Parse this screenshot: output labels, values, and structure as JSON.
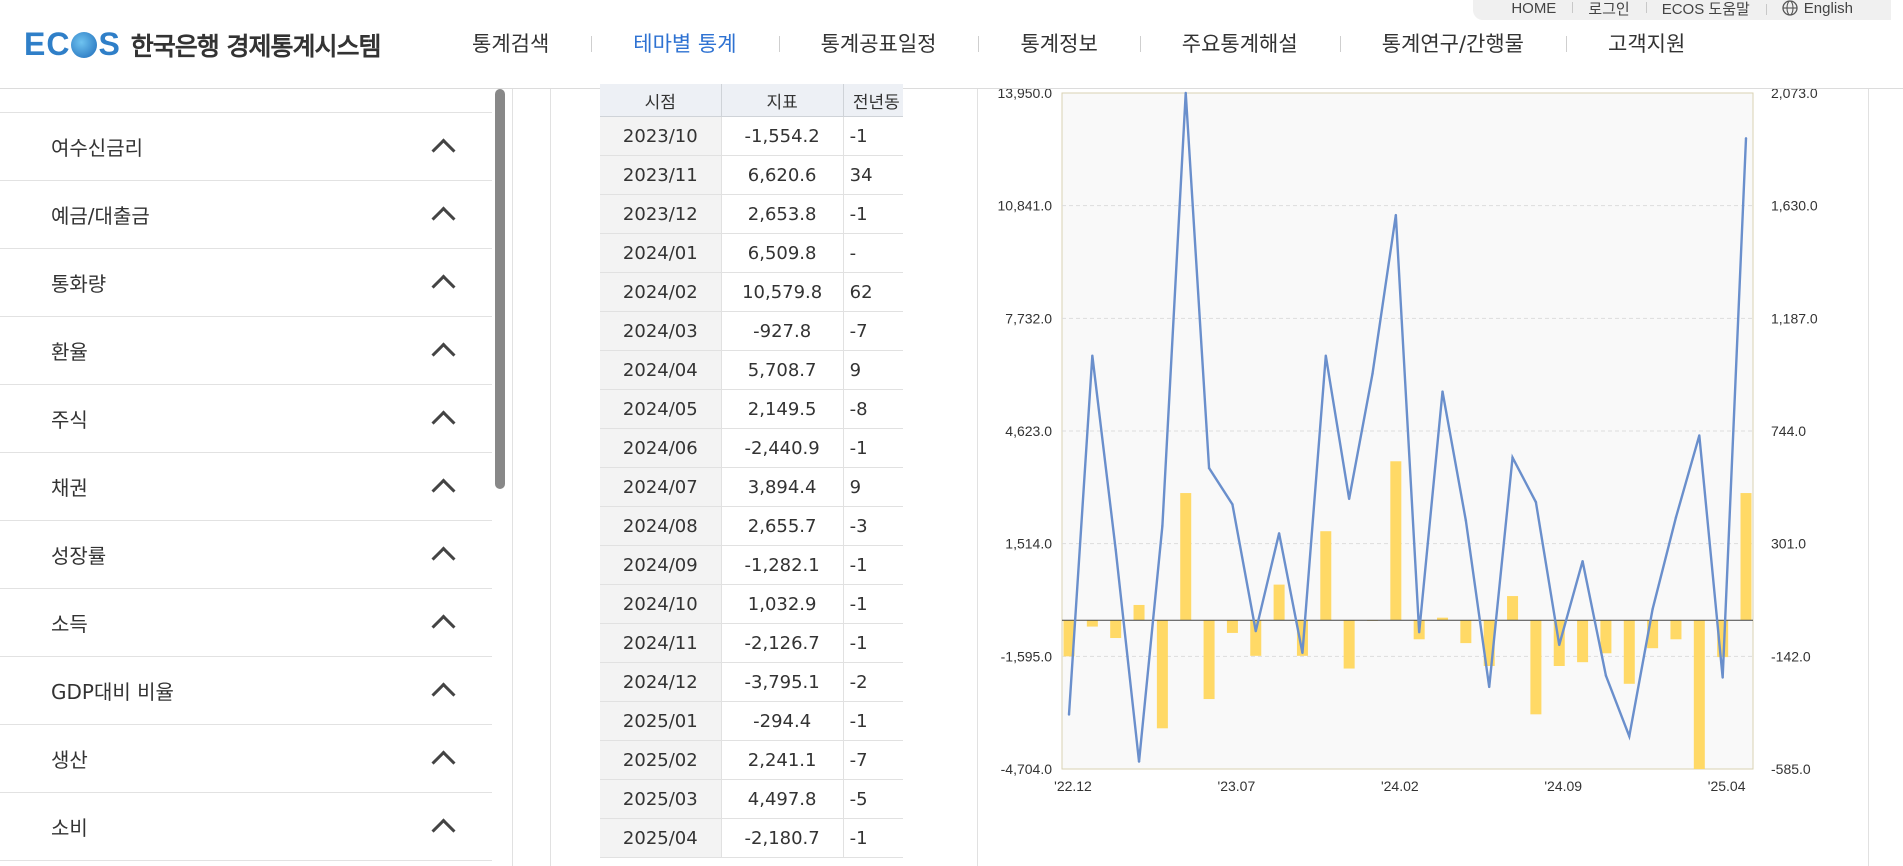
{
  "header": {
    "logo_mark": "ECOS",
    "logo_text": "한국은행 경제통계시스템",
    "nav": [
      {
        "label": "통계검색",
        "active": false
      },
      {
        "label": "테마별 통계",
        "active": true
      },
      {
        "label": "통계공표일정",
        "active": false
      },
      {
        "label": "통계정보",
        "active": false
      },
      {
        "label": "주요통계해설",
        "active": false
      },
      {
        "label": "통계연구/간행물",
        "active": false
      },
      {
        "label": "고객지원",
        "active": false
      }
    ],
    "util": {
      "home": "HOME",
      "login": "로그인",
      "help": "ECOS 도움말",
      "english": "English"
    }
  },
  "sidebar": {
    "items": [
      {
        "label": "여수신금리"
      },
      {
        "label": "예금/대출금"
      },
      {
        "label": "통화량"
      },
      {
        "label": "환율"
      },
      {
        "label": "주식"
      },
      {
        "label": "채권"
      },
      {
        "label": "성장률"
      },
      {
        "label": "소득"
      },
      {
        "label": "GDP대비 비율"
      },
      {
        "label": "생산"
      },
      {
        "label": "소비"
      }
    ]
  },
  "table": {
    "headers": [
      "시점",
      "지표",
      "전년동"
    ],
    "rows": [
      {
        "date": "2023/10",
        "value": "-1,554.2",
        "yoy": "-1"
      },
      {
        "date": "2023/11",
        "value": "6,620.6",
        "yoy": "34"
      },
      {
        "date": "2023/12",
        "value": "2,653.8",
        "yoy": "-1"
      },
      {
        "date": "2024/01",
        "value": "6,509.8",
        "yoy": "-"
      },
      {
        "date": "2024/02",
        "value": "10,579.8",
        "yoy": "62"
      },
      {
        "date": "2024/03",
        "value": "-927.8",
        "yoy": "-7"
      },
      {
        "date": "2024/04",
        "value": "5,708.7",
        "yoy": "9"
      },
      {
        "date": "2024/05",
        "value": "2,149.5",
        "yoy": "-8"
      },
      {
        "date": "2024/06",
        "value": "-2,440.9",
        "yoy": "-1"
      },
      {
        "date": "2024/07",
        "value": "3,894.4",
        "yoy": "9"
      },
      {
        "date": "2024/08",
        "value": "2,655.7",
        "yoy": "-3"
      },
      {
        "date": "2024/09",
        "value": "-1,282.1",
        "yoy": "-1"
      },
      {
        "date": "2024/10",
        "value": "1,032.9",
        "yoy": "-1"
      },
      {
        "date": "2024/11",
        "value": "-2,126.7",
        "yoy": "-1"
      },
      {
        "date": "2024/12",
        "value": "-3,795.1",
        "yoy": "-2"
      },
      {
        "date": "2025/01",
        "value": "-294.4",
        "yoy": "-1"
      },
      {
        "date": "2025/02",
        "value": "2,241.1",
        "yoy": "-7"
      },
      {
        "date": "2025/03",
        "value": "4,497.8",
        "yoy": "-5"
      },
      {
        "date": "2025/04",
        "value": "-2,180.7",
        "yoy": "-1"
      }
    ]
  },
  "chart_data": {
    "type": "bar",
    "left_axis": {
      "ticks": [
        "13,950.0",
        "10,841.0",
        "7,732.0",
        "4,623.0",
        "1,514.0",
        "-1,595.0",
        "-4,704.0"
      ],
      "min": -4704,
      "max": 13950
    },
    "right_axis": {
      "ticks": [
        "2,073.0",
        "1,630.0",
        "1,187.0",
        "744.0",
        "301.0",
        "-142.0",
        "-585.0"
      ],
      "min": -585,
      "max": 2073
    },
    "x_ticks": [
      {
        "label": "'22.12",
        "index": 0
      },
      {
        "label": "'23.07",
        "index": 7
      },
      {
        "label": "'24.02",
        "index": 14
      },
      {
        "label": "'24.09",
        "index": 21
      },
      {
        "label": "'25.04",
        "index": 28
      }
    ],
    "grid": true,
    "colors": {
      "bar": "#ffd966",
      "line": "#6a8fcc",
      "grid": "#dddddd",
      "plot_bg": "#f9f9f9",
      "plot_border": "#d9d2b3"
    },
    "series": [
      {
        "kind": "bar",
        "axis": "right",
        "values": [
          -142,
          -25,
          -70,
          60,
          -425,
          500,
          -310,
          -50,
          -140,
          140,
          -140,
          350,
          -190,
          0,
          625,
          -75,
          10,
          -90,
          -180,
          95,
          -370,
          -180,
          -165,
          -130,
          -250,
          -110,
          -75,
          -585,
          -145,
          500
        ]
      },
      {
        "kind": "line",
        "axis": "left",
        "values": [
          -3200,
          6700,
          1350,
          -4500,
          2000,
          13950,
          3600,
          2600,
          -900,
          1800,
          -1500,
          6700,
          2750,
          6200,
          10580,
          -930,
          5710,
          2150,
          -2440,
          3890,
          2660,
          -1280,
          1030,
          -2130,
          -3800,
          -290,
          2240,
          4500,
          -2180,
          12700
        ]
      }
    ]
  }
}
